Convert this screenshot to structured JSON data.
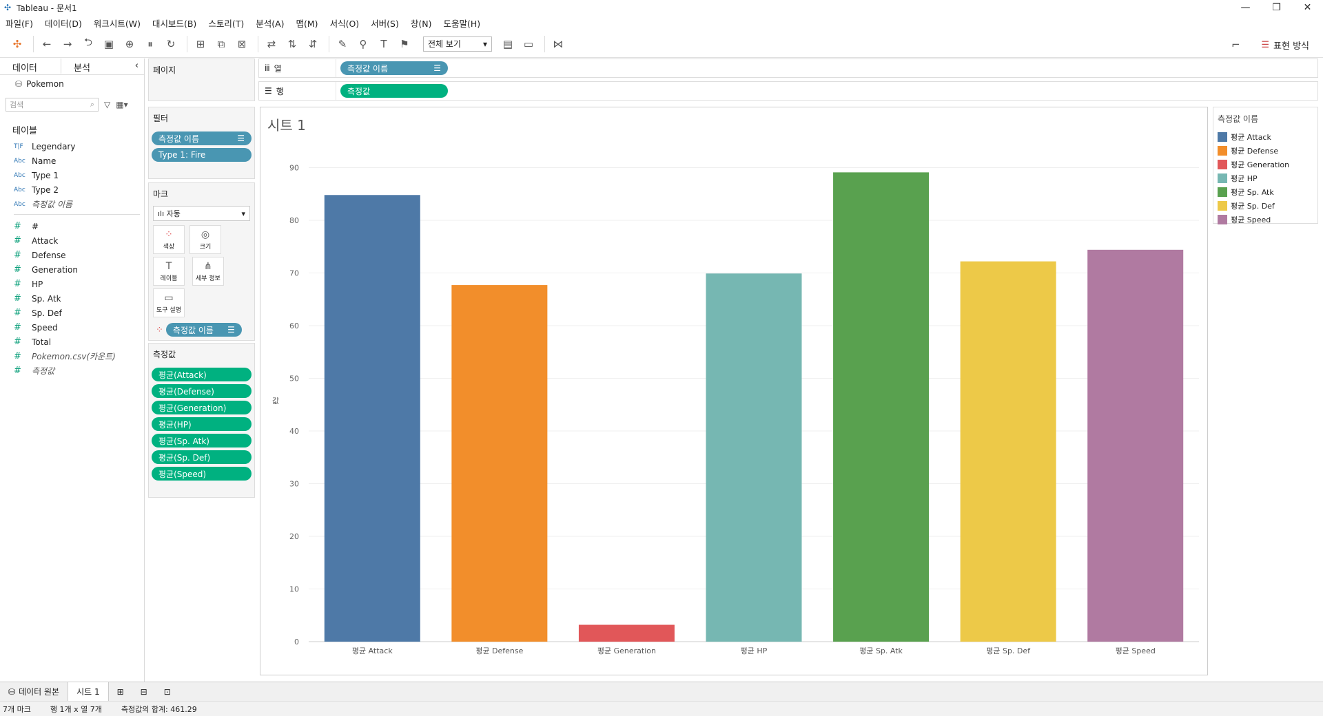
{
  "window": {
    "title": "Tableau - 문서1"
  },
  "menu": [
    "파일(F)",
    "데이터(D)",
    "워크시트(W)",
    "대시보드(B)",
    "스토리(T)",
    "분석(A)",
    "맵(M)",
    "서식(O)",
    "서버(S)",
    "창(N)",
    "도움말(H)"
  ],
  "toolbar": {
    "fit_select": "전체 보기",
    "show_me": "표현 방식"
  },
  "data_pane": {
    "tab_data": "데이터",
    "tab_analysis": "분석",
    "datasource": "Pokemon",
    "search_placeholder": "검색",
    "tables_header": "테이블",
    "dimensions": [
      {
        "type": "T|F",
        "name": "Legendary"
      },
      {
        "type": "Abc",
        "name": "Name"
      },
      {
        "type": "Abc",
        "name": "Type 1"
      },
      {
        "type": "Abc",
        "name": "Type 2"
      },
      {
        "type": "Abc",
        "name": "측정값 이름"
      }
    ],
    "measures": [
      {
        "type": "#",
        "name": "#"
      },
      {
        "type": "#",
        "name": "Attack"
      },
      {
        "type": "#",
        "name": "Defense"
      },
      {
        "type": "#",
        "name": "Generation"
      },
      {
        "type": "#",
        "name": "HP"
      },
      {
        "type": "#",
        "name": "Sp. Atk"
      },
      {
        "type": "#",
        "name": "Sp. Def"
      },
      {
        "type": "#",
        "name": "Speed"
      },
      {
        "type": "#",
        "name": "Total"
      },
      {
        "type": "#",
        "name": "Pokemon.csv(카운트)"
      },
      {
        "type": "#",
        "name": "측정값"
      }
    ]
  },
  "shelves": {
    "pages": "페이지",
    "filters": "필터",
    "filter_pills": [
      "측정값 이름",
      "Type 1: Fire"
    ],
    "marks": "마크",
    "mark_type": "자동",
    "mark_buttons": [
      "색상",
      "크기",
      "레이블",
      "세부 정보",
      "도구 설명"
    ],
    "color_pill": "측정값 이름",
    "measure_values": "측정값",
    "measure_pills": [
      "평균(Attack)",
      "평균(Defense)",
      "평균(Generation)",
      "평균(HP)",
      "평균(Sp. Atk)",
      "평균(Sp. Def)",
      "평균(Speed)"
    ],
    "columns_label": "열",
    "columns_pill": "측정값 이름",
    "rows_label": "행",
    "rows_pill": "측정값"
  },
  "sheet_title": "시트 1",
  "legend": {
    "title": "측정값 이름",
    "items": [
      {
        "label": "평균 Attack",
        "color": "#4e79a7"
      },
      {
        "label": "평균 Defense",
        "color": "#f28e2b"
      },
      {
        "label": "평균 Generation",
        "color": "#e15759"
      },
      {
        "label": "평균 HP",
        "color": "#76b7b2"
      },
      {
        "label": "평균 Sp. Atk",
        "color": "#59a14f"
      },
      {
        "label": "평균 Sp. Def",
        "color": "#edc948"
      },
      {
        "label": "평균 Speed",
        "color": "#b07aa1"
      }
    ]
  },
  "chart_data": {
    "type": "bar",
    "categories": [
      "평균 Attack",
      "평균 Defense",
      "평균 Generation",
      "평균 HP",
      "평균 Sp. Atk",
      "평균 Sp. Def",
      "평균 Speed"
    ],
    "values": [
      84.8,
      67.7,
      3.2,
      69.9,
      89.1,
      72.2,
      74.4
    ],
    "colors": [
      "#4e79a7",
      "#f28e2b",
      "#e15759",
      "#76b7b2",
      "#59a14f",
      "#edc948",
      "#b07aa1"
    ],
    "ylabel": "값",
    "yticks": [
      0,
      10,
      20,
      30,
      40,
      50,
      60,
      70,
      80,
      90
    ],
    "ylim": [
      0,
      90
    ],
    "grid": true
  },
  "bottom_tabs": {
    "datasource": "데이터 원본",
    "sheet": "시트 1"
  },
  "status": {
    "marks": "7개 마크",
    "rows_cols": "행 1개 x 열 7개",
    "sum": "측정값의 합계: 461.29"
  }
}
